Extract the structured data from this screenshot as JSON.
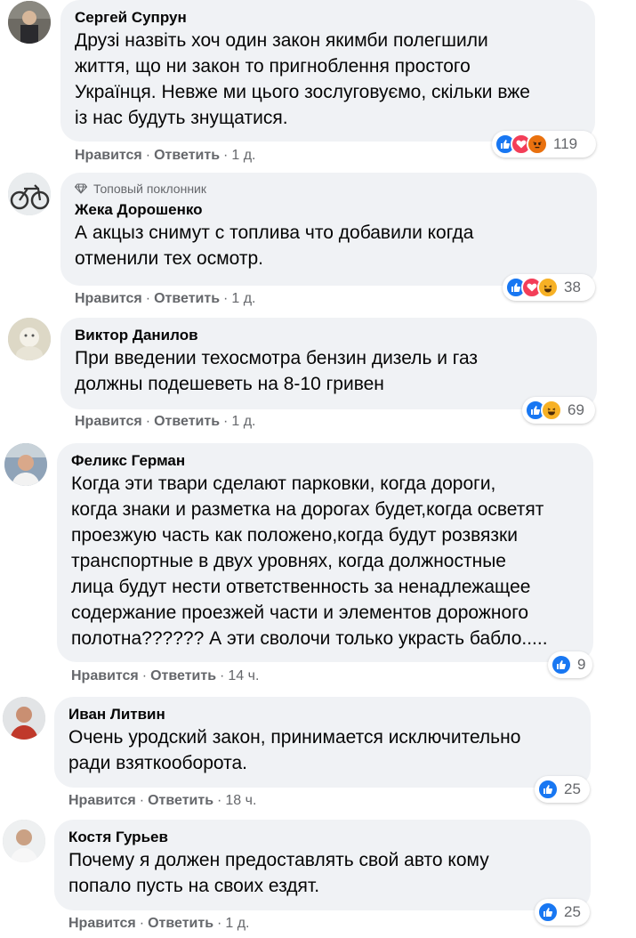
{
  "actions": {
    "like": "Нравится",
    "reply": "Ответить",
    "sep": "·"
  },
  "comments": [
    {
      "author": "Сергей Супрун",
      "text": "Друзі назвіть хоч один закон якимби полегшили\nжиття, що ни закон то пригноблення простого\nУкраїнця. Невже ми цього зослуговуємо, скільки вже\nіз нас будуть знущатися.",
      "time": "1 д.",
      "reaction_count": "119",
      "reactions": [
        "like",
        "love",
        "angry"
      ]
    },
    {
      "badge": "Топовый поклонник",
      "author": "Жека Дорошенко",
      "text": "А акцыз снимут с топлива что добавили когда\nотменили тех осмотр.",
      "time": "1 д.",
      "reaction_count": "38",
      "reactions": [
        "like",
        "love",
        "haha"
      ]
    },
    {
      "author": "Виктор Данилов",
      "text": "При введении техосмотра бензин дизель и газ\nдолжны подешеветь на 8-10 гривен",
      "time": "1 д.",
      "reaction_count": "69",
      "reactions": [
        "like",
        "haha"
      ]
    },
    {
      "author": "Феликс Герман",
      "text": "Когда эти твари сделают парковки, когда дороги,\nкогда знаки и разметка на дорогах будет,когда осветят\nпроезжую часть как положено,когда будут розвязки\nтранспортные в двух уровнях, когда должностные\nлица будут нести ответственность за ненадлежащее\nсодержание проезжей части и элементов дорожного\nполотна?????? А эти сволочи только украсть бабло.....",
      "time": "14 ч.",
      "reaction_count": "9",
      "reactions": [
        "like"
      ]
    },
    {
      "author": "Иван Литвин",
      "text": "Очень уродский закон, принимается исключительно\nради взяткооборота.",
      "time": "18 ч.",
      "reaction_count": "25",
      "reactions": [
        "like"
      ]
    },
    {
      "author": "Костя Гурьев",
      "text": "Почему я должен предоставлять свой авто кому\nпопало пусть на своих ездят.",
      "time": "1 д.",
      "reaction_count": "25",
      "reactions": [
        "like"
      ]
    }
  ],
  "colors": {
    "bubble": "#f0f2f5",
    "like": "#1877f2",
    "love": "#f33e58",
    "angry": "#e9710f",
    "haha": "#f7b125",
    "meta": "#65676b"
  }
}
